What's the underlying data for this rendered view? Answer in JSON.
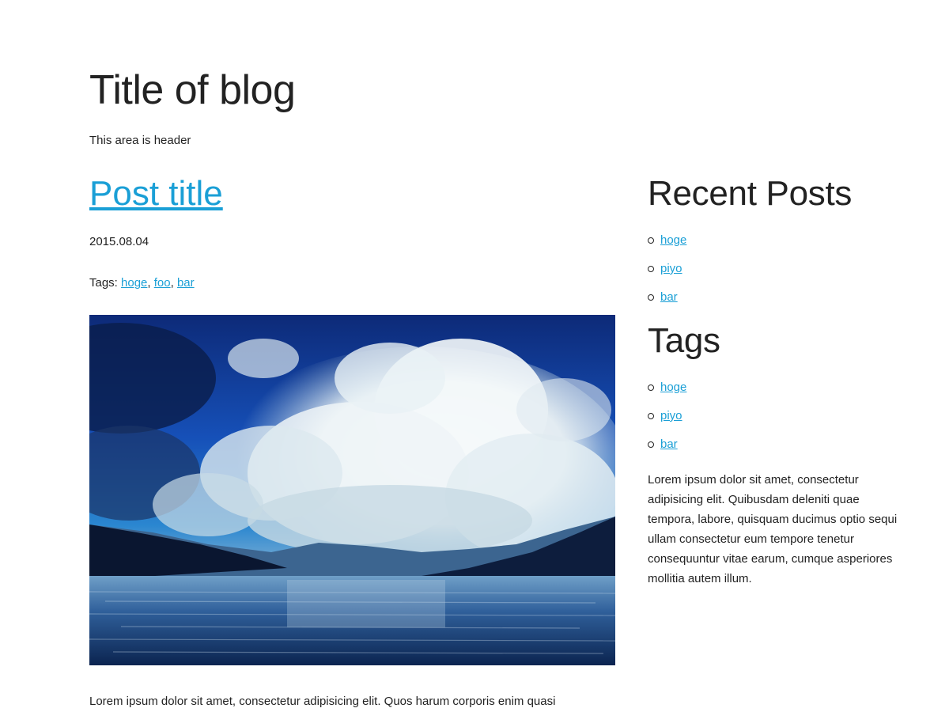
{
  "header": {
    "title": "Title of blog",
    "description": "This area is header"
  },
  "post": {
    "title": "Post title",
    "date": "2015.08.04",
    "tags_label": "Tags:",
    "tags": [
      "hoge",
      "foo",
      "bar"
    ],
    "body_first_line": "Lorem ipsum dolor sit amet, consectetur adipisicing elit. Quos harum corporis enim quasi",
    "image_subject": "landscape-photo-clouds-lake"
  },
  "sidebar": {
    "recent_heading": "Recent Posts",
    "recent_posts": [
      "hoge",
      "piyo",
      "bar"
    ],
    "tags_heading": "Tags",
    "tags": [
      "hoge",
      "piyo",
      "bar"
    ],
    "text": "Lorem ipsum dolor sit amet, consectetur adipisicing elit. Quibusdam deleniti quae tempora, labore, quisquam ducimus optio sequi ullam consectetur eum tempore tenetur consequuntur vitae earum, cumque asperiores mollitia autem illum."
  },
  "colors": {
    "link": "#1a9fd6",
    "text": "#222222"
  }
}
